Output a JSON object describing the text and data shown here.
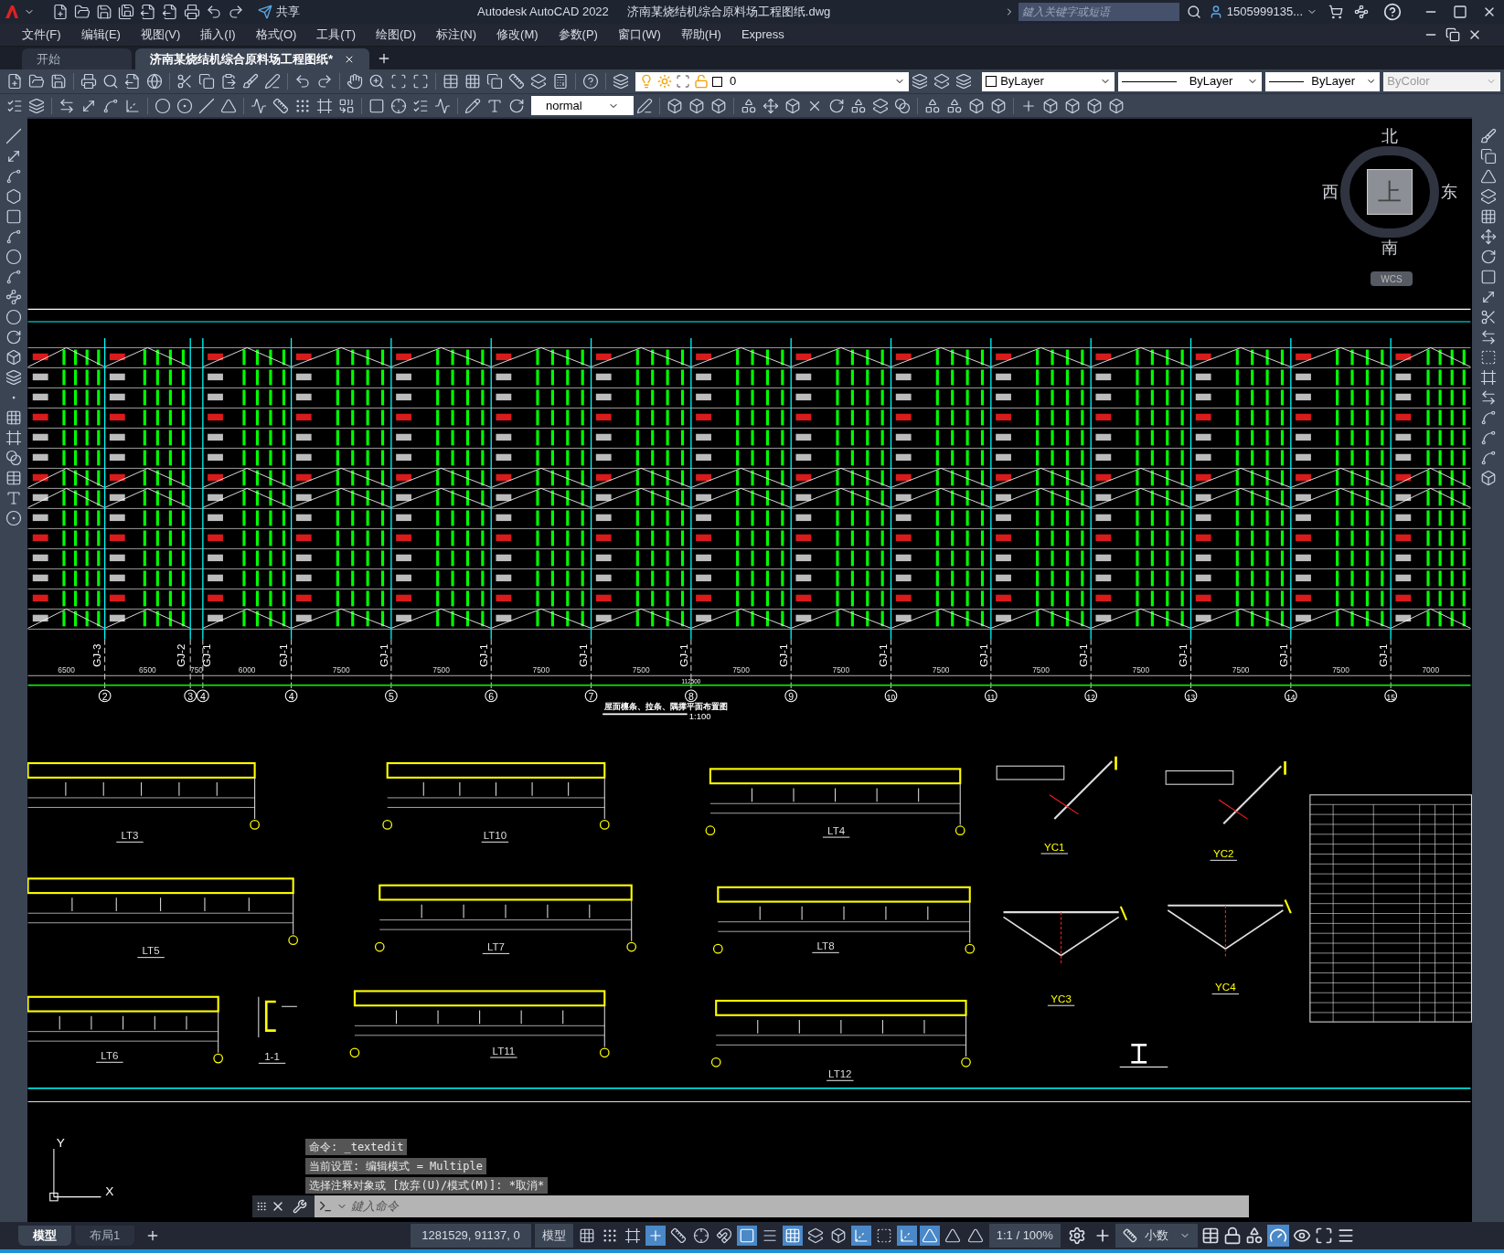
{
  "title_bar": {
    "share": "共享",
    "app_title": "Autodesk AutoCAD 2022",
    "file_name": "济南某烧结机综合原料场工程图纸.dwg",
    "search": {
      "placeholder": "鍵入关键字或短语"
    },
    "user": "1505999135..."
  },
  "menu": [
    "文件(F)",
    "编辑(E)",
    "视图(V)",
    "插入(I)",
    "格式(O)",
    "工具(T)",
    "绘图(D)",
    "标注(N)",
    "修改(M)",
    "参数(P)",
    "窗口(W)",
    "帮助(H)",
    "Express"
  ],
  "doc_tabs": [
    {
      "label": "开始",
      "selected": false
    },
    {
      "label": "济南某烧结机综合原料场工程图纸*",
      "selected": true
    }
  ],
  "toolbar": {
    "layer": "0",
    "text_style": "normal",
    "color_setting": "ByLayer",
    "linetype": "ByLayer",
    "lineweight": "ByLayer",
    "plot_style": {
      "value": "ByColor",
      "disabled": true
    }
  },
  "view_cube": {
    "north": "北",
    "south": "南",
    "west": "西",
    "east": "东",
    "face": "上",
    "ucs": "WCS"
  },
  "plan": {
    "frames": [
      "GJ-3",
      "GJ-2",
      "GJ-1",
      "GJ-1",
      "GJ-1",
      "GJ-1",
      "GJ-1",
      "GJ-1",
      "GJ-1",
      "GJ-1",
      "GJ-1",
      "GJ-1",
      "GJ-1",
      "GJ-1",
      "GJ-1"
    ],
    "axes": [
      "2",
      "3",
      "4",
      "4",
      "5",
      "6",
      "7",
      "8",
      "9",
      "10",
      "11",
      "12",
      "13",
      "14",
      "15"
    ],
    "dims": [
      "6500",
      "6500",
      "750",
      "6000",
      "7500",
      "7500",
      "7500",
      "7500",
      "7500",
      "7500",
      "7500",
      "7500",
      "7500",
      "7500",
      "7500",
      "7000"
    ],
    "total_dim": "112500",
    "title": "屋面檩条、拉条、隅撑平面布置图",
    "scale": "1:100"
  },
  "ucs_axes": {
    "y": "Y",
    "x": "X"
  },
  "details": [
    "LT3",
    "LT10",
    "LT4",
    "YC1",
    "YC2",
    "LT5",
    "LT7",
    "LT8",
    "YC3",
    "YC4",
    "LT6",
    "1-1",
    "LT11",
    "LT12"
  ],
  "command_history": [
    "命令: _textedit",
    "当前设置: 编辑模式 = Multiple",
    "选择注释对象或 [放弃(U)/模式(M)]: *取消*"
  ],
  "command_input": {
    "placeholder": "鍵入命令"
  },
  "layout_tabs": [
    {
      "label": "模型",
      "selected": true
    },
    {
      "label": "布局1",
      "selected": false
    }
  ],
  "status_bar": {
    "coordinates": "1281529, 91137, 0",
    "space": "模型",
    "annotation_scale": "1:1 / 100%",
    "units": "小数",
    "toggles": [
      {
        "on": false
      },
      {
        "on": false
      },
      {
        "on": false
      },
      {
        "on": true
      },
      {
        "on": false
      },
      {
        "on": false
      },
      {
        "on": false
      },
      {
        "on": true
      },
      {
        "on": false
      },
      {
        "on": true
      },
      {
        "on": false
      },
      {
        "on": false
      },
      {
        "on": true
      },
      {
        "on": false
      },
      {
        "on": true
      },
      {
        "on": true
      },
      {
        "on": false
      },
      {
        "on": false
      }
    ]
  }
}
